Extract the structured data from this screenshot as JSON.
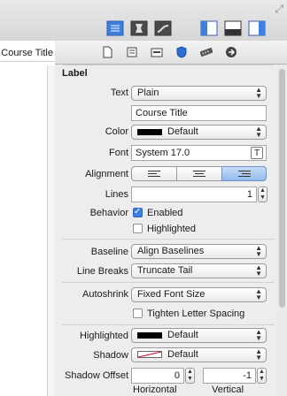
{
  "left_pane": {
    "course_title": "Course Title"
  },
  "toolbar": {
    "editor_buttons": [
      "standard-editor-icon",
      "assistant-editor-icon",
      "version-editor-icon"
    ],
    "view_buttons": [
      "navigator-toggle-icon",
      "debug-area-toggle-icon",
      "utilities-toggle-icon"
    ],
    "accent": "#3d7fe0"
  },
  "inspector_tabs": [
    "file-inspector-icon",
    "quick-help-icon",
    "identity-inspector-icon",
    "attributes-inspector-icon",
    "size-inspector-icon",
    "connections-inspector-icon"
  ],
  "section": {
    "title": "Label"
  },
  "text": {
    "label": "Text",
    "value": "Plain",
    "content": "Course Title"
  },
  "color": {
    "label": "Color",
    "value": "Default",
    "swatch": "#000000"
  },
  "font": {
    "label": "Font",
    "value": "System 17.0"
  },
  "alignment": {
    "label": "Alignment",
    "selected": "right"
  },
  "lines": {
    "label": "Lines",
    "value": "1"
  },
  "behavior": {
    "label": "Behavior",
    "enabled_label": "Enabled",
    "enabled": true,
    "highlighted_label": "Highlighted",
    "highlighted": false
  },
  "baseline": {
    "label": "Baseline",
    "value": "Align Baselines"
  },
  "line_breaks": {
    "label": "Line Breaks",
    "value": "Truncate Tail"
  },
  "autoshrink": {
    "label": "Autoshrink",
    "value": "Fixed Font Size",
    "tighten_label": "Tighten Letter Spacing",
    "tighten": false
  },
  "highlighted_color": {
    "label": "Highlighted",
    "value": "Default",
    "swatch": "#000000"
  },
  "shadow": {
    "label": "Shadow",
    "value": "Default"
  },
  "shadow_offset": {
    "label": "Shadow Offset",
    "horizontal": "0",
    "vertical": "-1",
    "horizontal_label": "Horizontal",
    "vertical_label": "Vertical"
  }
}
